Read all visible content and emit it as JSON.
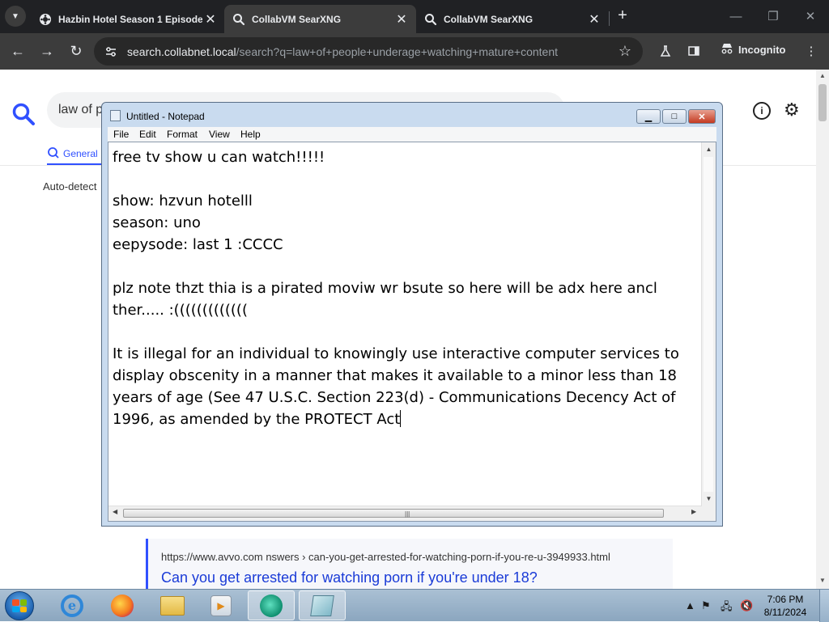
{
  "browser": {
    "tabs": [
      {
        "title": "Hazbin Hotel Season 1 Episode",
        "favicon": "film-icon",
        "active": false
      },
      {
        "title": "CollabVM SearXNG",
        "favicon": "searxng-icon",
        "active": true
      },
      {
        "title": "CollabVM SearXNG",
        "favicon": "searxng-icon",
        "active": false
      }
    ],
    "url_host": "search.collabnet.local",
    "url_path": "/search?q=law+of+people+underage+watching+mature+content",
    "profile_label": "Incognito"
  },
  "searxng": {
    "query": "law of p",
    "category_tab": "General",
    "autodetect_label": "Auto-detect",
    "result": {
      "url": "https://www.avvo.com  nswers › can-you-get-arrested-for-watching-porn-if-you-re-u-3949933.html",
      "title": "Can you get arrested for watching porn if you're under 18?"
    }
  },
  "notepad": {
    "title": "Untitled - Notepad",
    "menu": [
      "File",
      "Edit",
      "Format",
      "View",
      "Help"
    ],
    "content": "free tv show u can watch!!!!!\n\nshow: hzvun hotelll\nseason: uno\neepysode: last 1 :CCCC\n\nplz note thzt thia is a pirated moviw wr bsute so here will be adx here ancl ther..... :(((((((((((((\n\nIt is illegal for an individual to knowingly use interactive computer services to display obscenity in a manner that makes it available to a minor less than 18 years of age (See 47 U.S.C. Section 223(d) - Communications Decency Act of 1996, as amended by the PROTECT Act"
  },
  "taskbar": {
    "apps": [
      "internet-explorer",
      "firefox",
      "windows-explorer",
      "media-player",
      "collabvm",
      "notepad"
    ],
    "clock_time": "7:06 PM",
    "clock_date": "8/11/2024"
  },
  "colors": {
    "chrome_dark": "#202124",
    "searxng_blue": "#3050ff",
    "taskbar": "#8ba6bf"
  }
}
